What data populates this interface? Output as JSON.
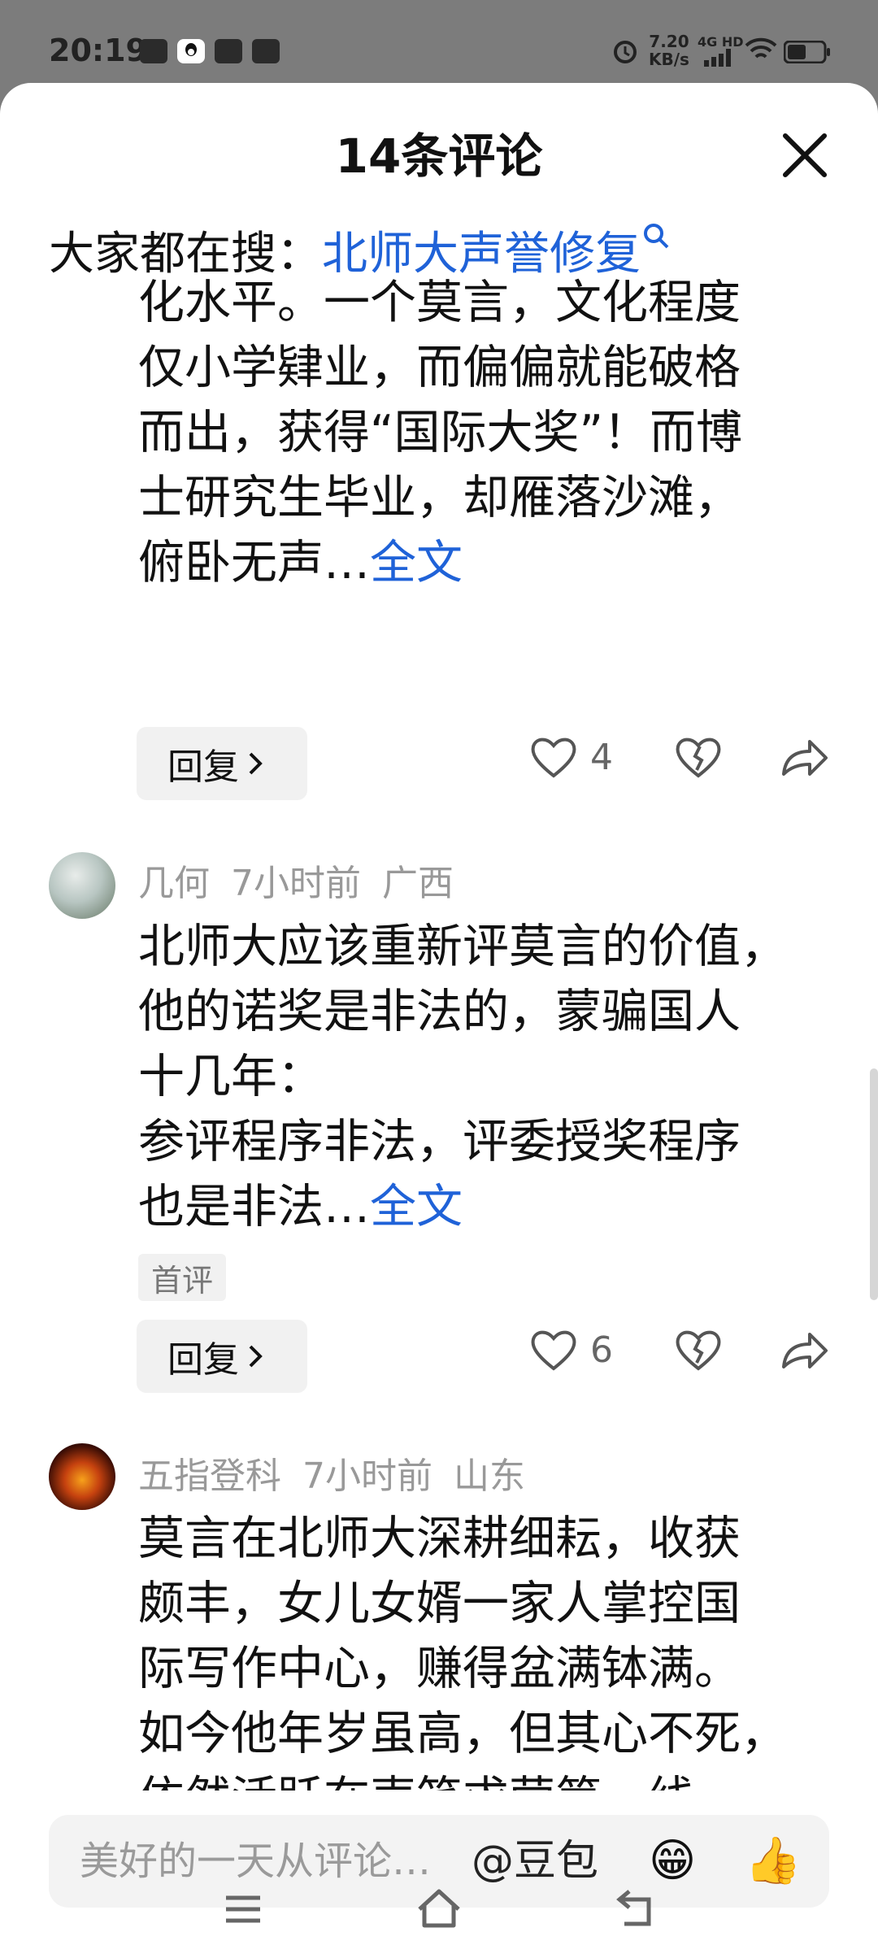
{
  "status": {
    "time": "20:19",
    "net_speed": "7.20",
    "net_unit": "KB/s",
    "net_type": "4G HD"
  },
  "header": {
    "title": "14条评论"
  },
  "search": {
    "prefix": "大家都在搜：",
    "link": "北师大声誉修复"
  },
  "comments": [
    {
      "lines": [
        "化水平。一个莫言，文化程度",
        "仅小学肄业，而偏偏就能破格",
        "而出，获得“国际大奖”！而博",
        "士研究生毕业，却雁落沙滩，",
        "俯卧无声…"
      ],
      "more": "全文",
      "likes": "4"
    },
    {
      "user": "几何",
      "time": "7小时前",
      "region": "广西",
      "lines": [
        "北师大应该重新评莫言的价值，",
        "他的诺奖是非法的，蒙骗国人",
        "十几年：",
        "参评程序非法，评委授奖程序",
        "也是非法…"
      ],
      "more": "全文",
      "tag": "首评",
      "likes": "6"
    },
    {
      "user": "五指登科",
      "time": "7小时前",
      "region": "山东",
      "lines": [
        "莫言在北师大深耕细耘，收获",
        "颇丰，女儿女婿一家人掌控国",
        "际写作中心，赚得盆满钵满。",
        "如今他年岁虽高，但其心不死，",
        "依然活跃在声笔求荣第一线"
      ]
    }
  ],
  "reply_label": "回复",
  "input": {
    "placeholder": "美好的一天从评论开始",
    "at_label": "@豆包"
  },
  "colors": {
    "link": "#1f62d8",
    "background": "#ffffff",
    "status_bar": "#7c7c7c"
  }
}
